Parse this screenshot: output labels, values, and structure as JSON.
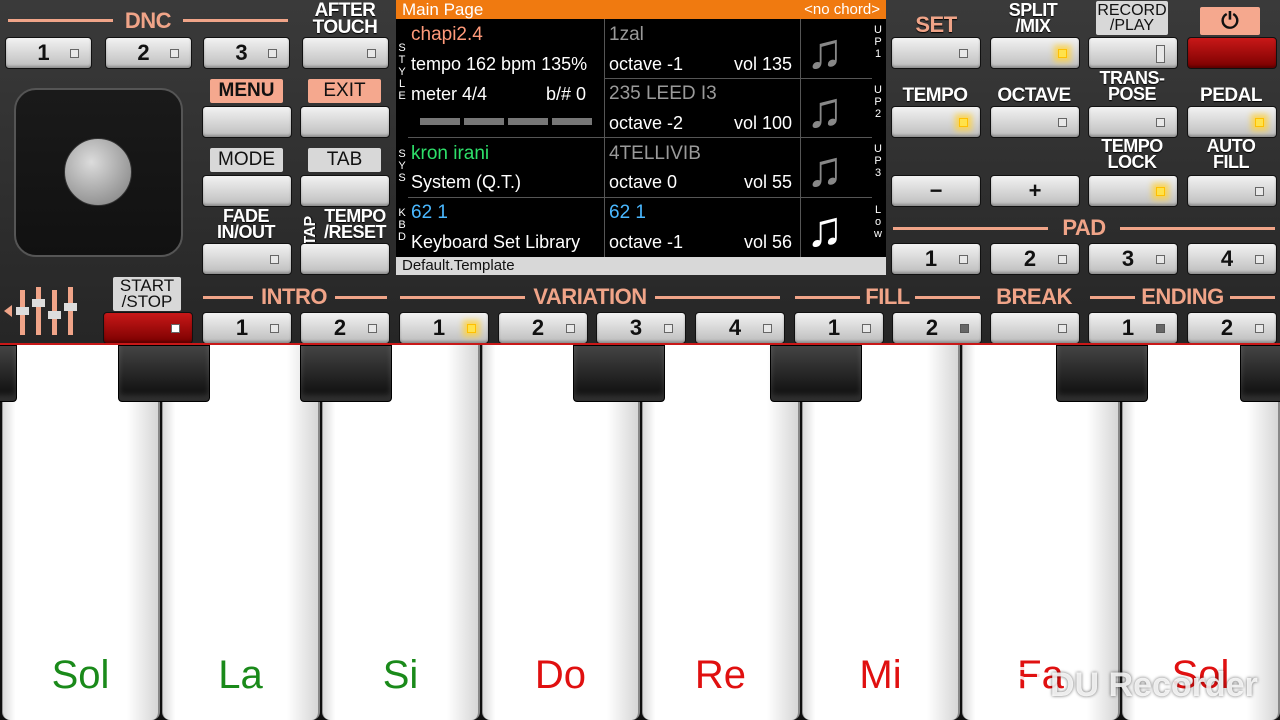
{
  "top": {
    "dnc": "DNC",
    "after_touch": [
      "AFTER",
      "TOUCH"
    ],
    "dnc_buttons": [
      "1",
      "2",
      "3"
    ],
    "menu": "MENU",
    "exit": "EXIT",
    "mode": "MODE",
    "tab": "TAB",
    "fade": [
      "FADE",
      "IN/OUT"
    ],
    "tap": "TAP",
    "tempo_reset": [
      "TEMPO",
      "/RESET"
    ],
    "start_stop": [
      "START",
      "/STOP"
    ]
  },
  "screen": {
    "title": "Main Page",
    "chord": "<no chord>",
    "footer": "Default.Template",
    "style_name": "chapi2.4",
    "tempo_text": "tempo 162 bpm 135%",
    "meter": "meter 4/4",
    "bsharp": "b/#  0",
    "sys_name": "kron irani",
    "sys_value": "System (Q.T.)",
    "kbd_name": "62 1",
    "kbd_value": "Keyboard Set Library",
    "side_style": "STYLE",
    "side_sys": "SYS",
    "side_kbd": "KBD",
    "tracks": [
      {
        "name": "1zal",
        "octave": "octave -1",
        "vol": "vol 135",
        "side": "UP1"
      },
      {
        "name": "235 LEED I3",
        "octave": "octave -2",
        "vol": "vol 100",
        "side": "UP2"
      },
      {
        "name": "4TELLIVIB",
        "octave": "octave  0",
        "vol": "vol 55",
        "side": "UP3"
      },
      {
        "name": "62 1",
        "octave": "octave -1",
        "vol": "vol 56",
        "side": "Low"
      }
    ]
  },
  "right": {
    "set": "SET",
    "split_mix": [
      "SPLIT",
      "/MIX"
    ],
    "record_play": [
      "RECORD",
      "/PLAY"
    ],
    "power_icon": "power-icon",
    "tempo": "TEMPO",
    "octave": "OCTAVE",
    "transpose": [
      "TRANS-",
      "POSE"
    ],
    "pedal": "PEDAL",
    "tempo_lock": [
      "TEMPO",
      "LOCK"
    ],
    "auto_fill": [
      "AUTO",
      "FILL"
    ],
    "minus": "−",
    "plus": "+",
    "pad": "PAD",
    "pad_buttons": [
      "1",
      "2",
      "3",
      "4"
    ]
  },
  "bottom": {
    "intro": "INTRO",
    "variation": "VARIATION",
    "fill": "FILL",
    "break": "BREAK",
    "ending": "ENDING",
    "intro_buttons": [
      "1",
      "2"
    ],
    "variation_buttons": [
      "1",
      "2",
      "3",
      "4"
    ],
    "fill_buttons": [
      "1",
      "2"
    ],
    "ending_buttons": [
      "1",
      "2"
    ]
  },
  "keyboard": {
    "notes": [
      "Sol",
      "La",
      "Si",
      "Do",
      "Re",
      "Mi",
      "Fa",
      "Sol"
    ],
    "note_colors": [
      "#1a8a1a",
      "#1a8a1a",
      "#1a8a1a",
      "#e01010",
      "#e01010",
      "#e01010",
      "#e01010",
      "#e01010"
    ]
  },
  "watermark": "DU Recorder",
  "colors": {
    "accent": "#f0a488",
    "screen_title_bar": "#f07a10",
    "style_name": "#ff9a7a",
    "sys_name": "#2ee06a",
    "kbd_name": "#4ab8ff",
    "track_dim": "#9a9a9a"
  }
}
